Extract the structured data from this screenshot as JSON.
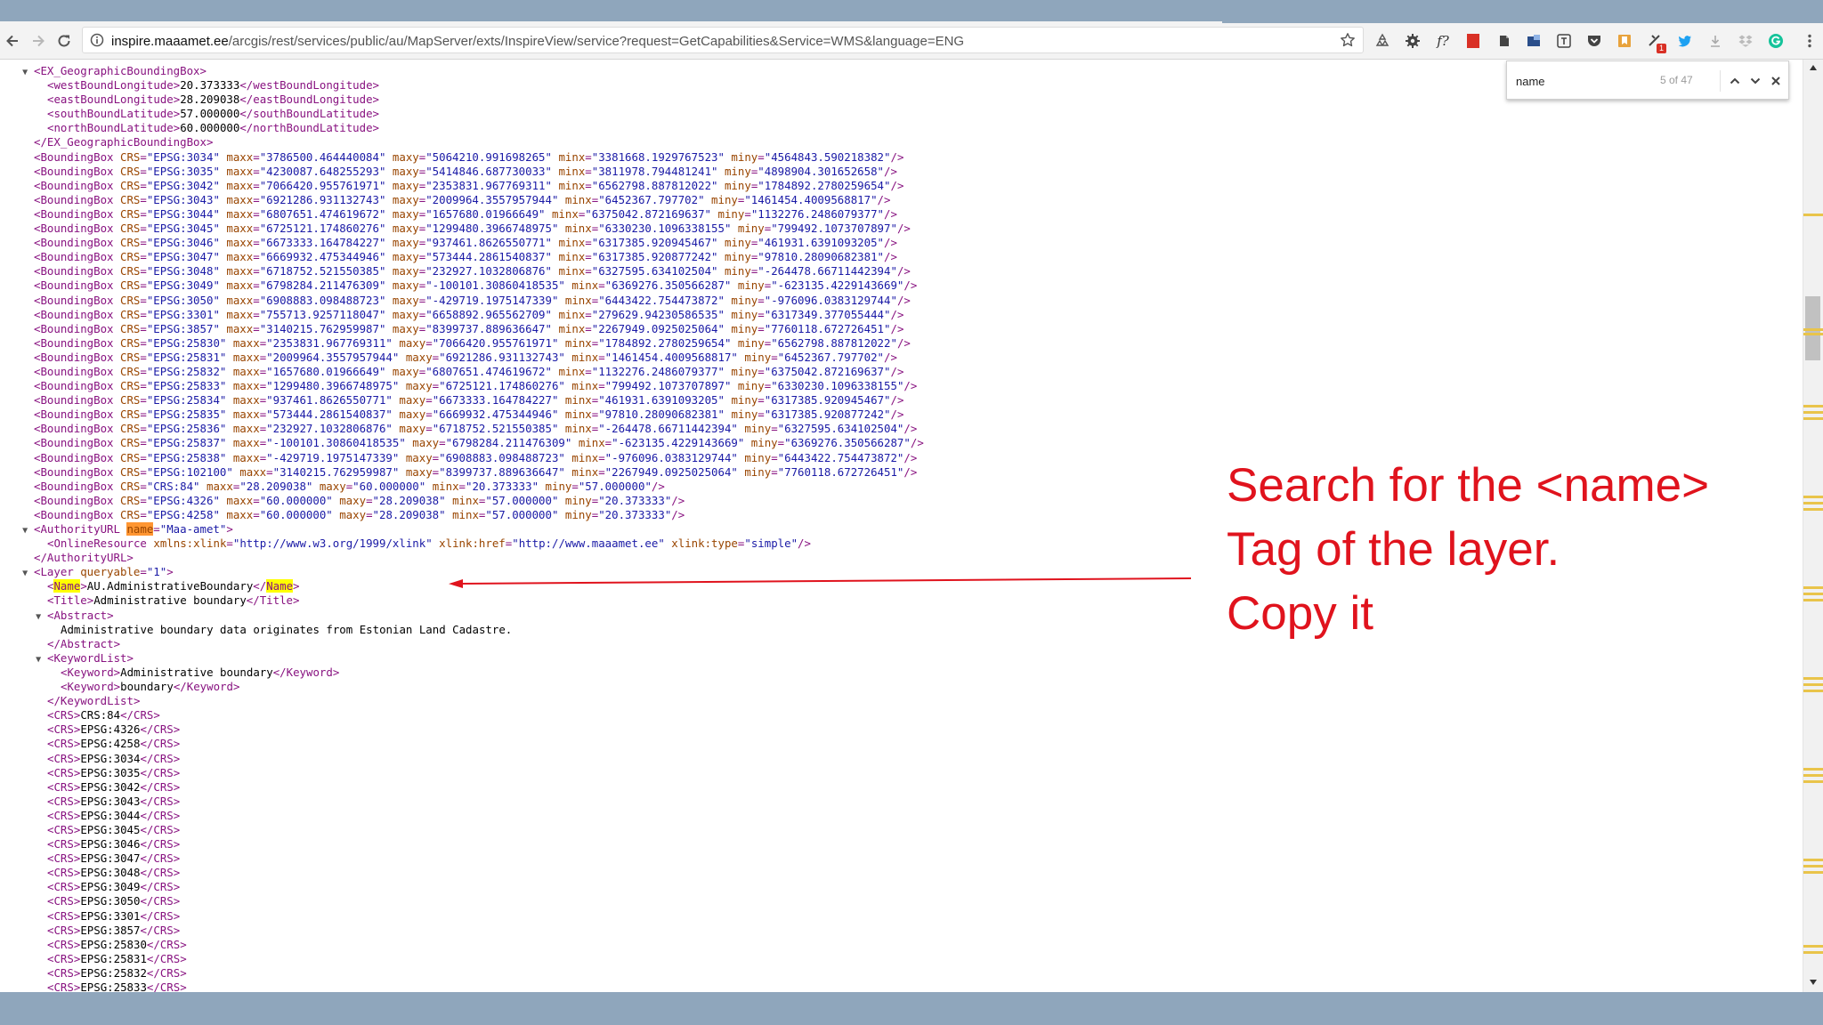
{
  "browser": {
    "url_host": "inspire.maaamet.ee",
    "url_path": "/arcgis/rest/services/public/au/MapServer/exts/InspireView/service?request=GetCapabilities&Service=WMS&language=ENG",
    "extension_badge": "1"
  },
  "find": {
    "query": "name",
    "count": "5 of 47"
  },
  "annotation": {
    "lines": [
      "Search for the <name>",
      "Tag of the layer.",
      "Copy it"
    ]
  },
  "colors": {
    "annotation": "#e0131d",
    "highlight": "#ffff00",
    "current_match": "#ff9632"
  },
  "xml": {
    "lines": [
      {
        "indent": 4,
        "tri": "▼",
        "parts": [
          [
            "tag",
            "<EX_GeographicBoundingBox>"
          ]
        ]
      },
      {
        "indent": 6,
        "parts": [
          [
            "tag",
            "<westBoundLongitude>"
          ],
          [
            "tx",
            "20.373333"
          ],
          [
            "tag",
            "</westBoundLongitude>"
          ]
        ]
      },
      {
        "indent": 6,
        "parts": [
          [
            "tag",
            "<eastBoundLongitude>"
          ],
          [
            "tx",
            "28.209038"
          ],
          [
            "tag",
            "</eastBoundLongitude>"
          ]
        ]
      },
      {
        "indent": 6,
        "parts": [
          [
            "tag",
            "<southBoundLatitude>"
          ],
          [
            "tx",
            "57.000000"
          ],
          [
            "tag",
            "</southBoundLatitude>"
          ]
        ]
      },
      {
        "indent": 6,
        "parts": [
          [
            "tag",
            "<northBoundLatitude>"
          ],
          [
            "tx",
            "60.000000"
          ],
          [
            "tag",
            "</northBoundLatitude>"
          ]
        ]
      },
      {
        "indent": 4,
        "parts": [
          [
            "tag",
            "</EX_GeographicBoundingBox>"
          ]
        ]
      },
      {
        "indent": 4,
        "bbox": [
          "EPSG:3034",
          "3786500.464440084",
          "5064210.991698265",
          "3381668.1929767523",
          "4564843.590218382"
        ]
      },
      {
        "indent": 4,
        "bbox": [
          "EPSG:3035",
          "4230087.648255293",
          "5414846.687730033",
          "3811978.794481241",
          "4898904.301652658"
        ]
      },
      {
        "indent": 4,
        "bbox": [
          "EPSG:3042",
          "7066420.955761971",
          "2353831.967769311",
          "6562798.887812022",
          "1784892.2780259654"
        ]
      },
      {
        "indent": 4,
        "bbox": [
          "EPSG:3043",
          "6921286.931132743",
          "2009964.3557957944",
          "6452367.797702",
          "1461454.4009568817"
        ]
      },
      {
        "indent": 4,
        "bbox": [
          "EPSG:3044",
          "6807651.474619672",
          "1657680.01966649",
          "6375042.872169637",
          "1132276.2486079377"
        ]
      },
      {
        "indent": 4,
        "bbox": [
          "EPSG:3045",
          "6725121.174860276",
          "1299480.3966748975",
          "6330230.1096338155",
          "799492.1073707897"
        ]
      },
      {
        "indent": 4,
        "bbox": [
          "EPSG:3046",
          "6673333.164784227",
          "937461.8626550771",
          "6317385.920945467",
          "461931.6391093205"
        ]
      },
      {
        "indent": 4,
        "bbox": [
          "EPSG:3047",
          "6669932.475344946",
          "573444.2861540837",
          "6317385.920877242",
          "97810.28090682381"
        ]
      },
      {
        "indent": 4,
        "bbox": [
          "EPSG:3048",
          "6718752.521550385",
          "232927.1032806876",
          "6327595.634102504",
          "-264478.66711442394"
        ]
      },
      {
        "indent": 4,
        "bbox": [
          "EPSG:3049",
          "6798284.211476309",
          "-100101.30860418535",
          "6369276.350566287",
          "-623135.4229143669"
        ]
      },
      {
        "indent": 4,
        "bbox": [
          "EPSG:3050",
          "6908883.098488723",
          "-429719.1975147339",
          "6443422.754473872",
          "-976096.0383129744"
        ]
      },
      {
        "indent": 4,
        "bbox": [
          "EPSG:3301",
          "755713.9257118047",
          "6658892.965562709",
          "279629.94230586535",
          "6317349.377055444"
        ]
      },
      {
        "indent": 4,
        "bbox": [
          "EPSG:3857",
          "3140215.762959987",
          "8399737.889636647",
          "2267949.0925025064",
          "7760118.672726451"
        ]
      },
      {
        "indent": 4,
        "bbox": [
          "EPSG:25830",
          "2353831.967769311",
          "7066420.955761971",
          "1784892.2780259654",
          "6562798.887812022"
        ]
      },
      {
        "indent": 4,
        "bbox": [
          "EPSG:25831",
          "2009964.3557957944",
          "6921286.931132743",
          "1461454.4009568817",
          "6452367.797702"
        ]
      },
      {
        "indent": 4,
        "bbox": [
          "EPSG:25832",
          "1657680.01966649",
          "6807651.474619672",
          "1132276.2486079377",
          "6375042.872169637"
        ]
      },
      {
        "indent": 4,
        "bbox": [
          "EPSG:25833",
          "1299480.3966748975",
          "6725121.174860276",
          "799492.1073707897",
          "6330230.1096338155"
        ]
      },
      {
        "indent": 4,
        "bbox": [
          "EPSG:25834",
          "937461.8626550771",
          "6673333.164784227",
          "461931.6391093205",
          "6317385.920945467"
        ]
      },
      {
        "indent": 4,
        "bbox": [
          "EPSG:25835",
          "573444.2861540837",
          "6669932.475344946",
          "97810.28090682381",
          "6317385.920877242"
        ]
      },
      {
        "indent": 4,
        "bbox": [
          "EPSG:25836",
          "232927.1032806876",
          "6718752.521550385",
          "-264478.66711442394",
          "6327595.634102504"
        ]
      },
      {
        "indent": 4,
        "bbox": [
          "EPSG:25837",
          "-100101.30860418535",
          "6798284.211476309",
          "-623135.4229143669",
          "6369276.350566287"
        ]
      },
      {
        "indent": 4,
        "bbox": [
          "EPSG:25838",
          "-429719.1975147339",
          "6908883.098488723",
          "-976096.0383129744",
          "6443422.754473872"
        ]
      },
      {
        "indent": 4,
        "bbox": [
          "EPSG:102100",
          "3140215.762959987",
          "8399737.889636647",
          "2267949.0925025064",
          "7760118.672726451"
        ]
      },
      {
        "indent": 4,
        "bbox": [
          "CRS:84",
          "28.209038",
          "60.000000",
          "20.373333",
          "57.000000"
        ]
      },
      {
        "indent": 4,
        "bbox": [
          "EPSG:4326",
          "60.000000",
          "28.209038",
          "57.000000",
          "20.373333"
        ]
      },
      {
        "indent": 4,
        "bbox": [
          "EPSG:4258",
          "60.000000",
          "28.209038",
          "57.000000",
          "20.373333"
        ]
      },
      {
        "indent": 4,
        "tri": "▼",
        "parts": [
          [
            "tag",
            "<AuthorityURL "
          ],
          [
            "an-cur",
            "name"
          ],
          [
            "tag",
            "="
          ],
          [
            "av",
            "\"Maa-amet\""
          ],
          [
            "tag",
            ">"
          ]
        ]
      },
      {
        "indent": 6,
        "parts": [
          [
            "tag",
            "<OnlineResource "
          ],
          [
            "an",
            "xmlns:xlink"
          ],
          [
            "tag",
            "="
          ],
          [
            "av",
            "\"http://www.w3.org/1999/xlink\""
          ],
          [
            "tag",
            " "
          ],
          [
            "an",
            "xlink:href"
          ],
          [
            "tag",
            "="
          ],
          [
            "av",
            "\"http://www.maaamet.ee\""
          ],
          [
            "tag",
            " "
          ],
          [
            "an",
            "xlink:type"
          ],
          [
            "tag",
            "="
          ],
          [
            "av",
            "\"simple\""
          ],
          [
            "tag",
            "/>"
          ]
        ]
      },
      {
        "indent": 4,
        "parts": [
          [
            "tag",
            "</AuthorityURL>"
          ]
        ]
      },
      {
        "indent": 4,
        "tri": "▼",
        "parts": [
          [
            "tag",
            "<Layer "
          ],
          [
            "an",
            "queryable"
          ],
          [
            "tag",
            "="
          ],
          [
            "av",
            "\"1\""
          ],
          [
            "tag",
            ">"
          ]
        ]
      },
      {
        "indent": 6,
        "parts": [
          [
            "tag",
            "<"
          ],
          [
            "tag-hl",
            "Name"
          ],
          [
            "tag",
            ">"
          ],
          [
            "tx",
            "AU.AdministrativeBoundary"
          ],
          [
            "tag",
            "</"
          ],
          [
            "tag-hl",
            "Name"
          ],
          [
            "tag",
            ">"
          ]
        ]
      },
      {
        "indent": 6,
        "parts": [
          [
            "tag",
            "<Title>"
          ],
          [
            "tx",
            "Administrative boundary"
          ],
          [
            "tag",
            "</Title>"
          ]
        ]
      },
      {
        "indent": 6,
        "tri": "▼",
        "parts": [
          [
            "tag",
            "<Abstract>"
          ]
        ]
      },
      {
        "indent": 8,
        "parts": [
          [
            "tx",
            "Administrative boundary data originates from Estonian Land Cadastre."
          ]
        ]
      },
      {
        "indent": 6,
        "parts": [
          [
            "tag",
            "</Abstract>"
          ]
        ]
      },
      {
        "indent": 6,
        "tri": "▼",
        "parts": [
          [
            "tag",
            "<KeywordList>"
          ]
        ]
      },
      {
        "indent": 8,
        "parts": [
          [
            "tag",
            "<Keyword>"
          ],
          [
            "tx",
            "Administrative boundary"
          ],
          [
            "tag",
            "</Keyword>"
          ]
        ]
      },
      {
        "indent": 8,
        "parts": [
          [
            "tag",
            "<Keyword>"
          ],
          [
            "tx",
            "boundary"
          ],
          [
            "tag",
            "</Keyword>"
          ]
        ]
      },
      {
        "indent": 6,
        "parts": [
          [
            "tag",
            "</KeywordList>"
          ]
        ]
      },
      {
        "indent": 6,
        "crs": "CRS:84"
      },
      {
        "indent": 6,
        "crs": "EPSG:4326"
      },
      {
        "indent": 6,
        "crs": "EPSG:4258"
      },
      {
        "indent": 6,
        "crs": "EPSG:3034"
      },
      {
        "indent": 6,
        "crs": "EPSG:3035"
      },
      {
        "indent": 6,
        "crs": "EPSG:3042"
      },
      {
        "indent": 6,
        "crs": "EPSG:3043"
      },
      {
        "indent": 6,
        "crs": "EPSG:3044"
      },
      {
        "indent": 6,
        "crs": "EPSG:3045"
      },
      {
        "indent": 6,
        "crs": "EPSG:3046"
      },
      {
        "indent": 6,
        "crs": "EPSG:3047"
      },
      {
        "indent": 6,
        "crs": "EPSG:3048"
      },
      {
        "indent": 6,
        "crs": "EPSG:3049"
      },
      {
        "indent": 6,
        "crs": "EPSG:3050"
      },
      {
        "indent": 6,
        "crs": "EPSG:3301"
      },
      {
        "indent": 6,
        "crs": "EPSG:3857"
      },
      {
        "indent": 6,
        "crs": "EPSG:25830"
      },
      {
        "indent": 6,
        "crs": "EPSG:25831"
      },
      {
        "indent": 6,
        "crs": "EPSG:25832"
      },
      {
        "indent": 6,
        "crs": "EPSG:25833"
      }
    ]
  }
}
